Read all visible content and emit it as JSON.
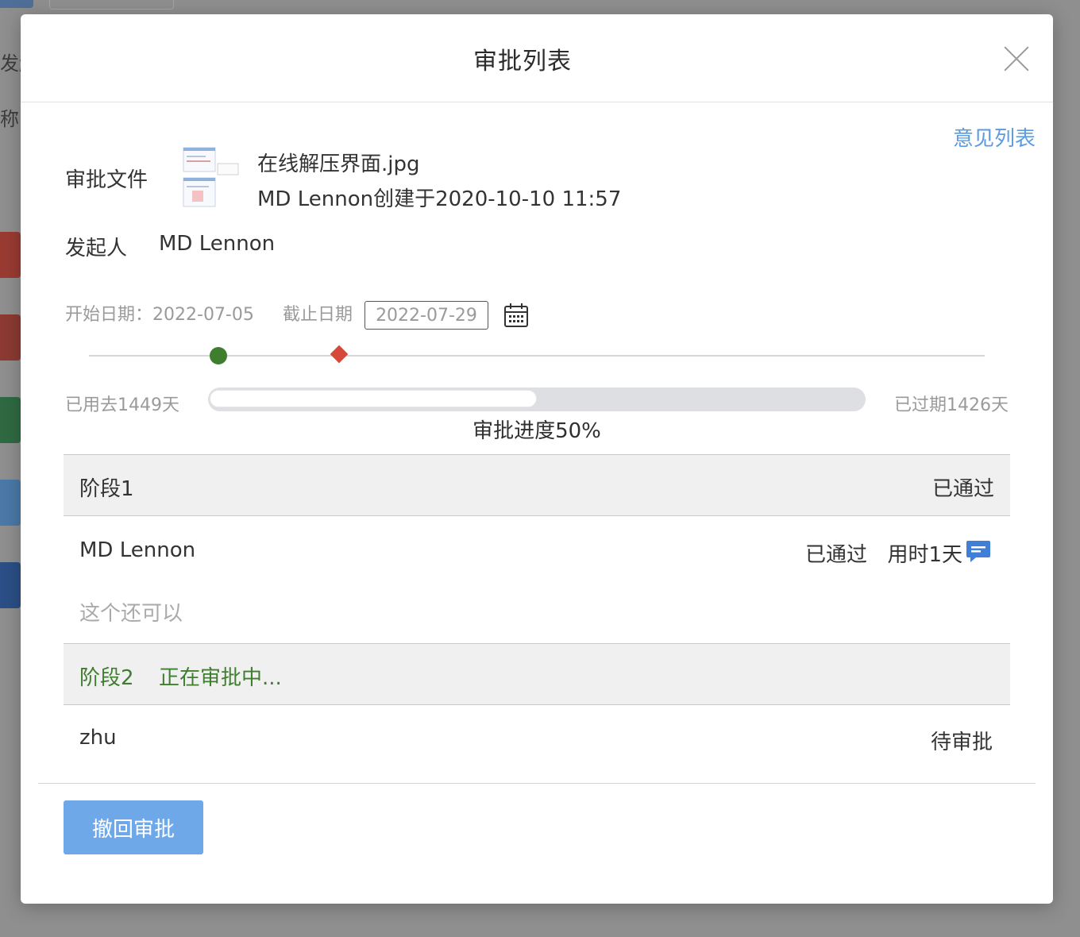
{
  "background": {
    "side_texts": [
      "发起",
      "称"
    ]
  },
  "modal": {
    "title": "审批列表",
    "opinion_link": "意见列表",
    "file_label": "审批文件",
    "file_name": "在线解压界面.jpg",
    "file_meta": "MD Lennon创建于2020-10-10 11:57",
    "initiator_label": "发起人",
    "initiator_name": "MD Lennon",
    "start_label": "开始日期：",
    "start_date": "2022-07-05",
    "end_label": "截止日期",
    "end_date": "2022-07-29",
    "used_days": "已用去1449天",
    "expired_days": "已过期1426天",
    "progress_label": "审批进度50%",
    "progress_fraction": 0.5,
    "stages": [
      {
        "title": "阶段1",
        "status": "已通过",
        "approver": "MD Lennon",
        "approver_status": "已通过",
        "duration": "用时1天",
        "comment": "这个还可以"
      },
      {
        "title": "阶段2",
        "status": "正在审批中...",
        "approver": "zhu",
        "approver_status": "待审批"
      }
    ],
    "revoke_button": "撤回审批"
  },
  "colors": {
    "accent": "#5b9be0",
    "button": "#6fa8e8",
    "green": "#3f7e2e",
    "red": "#d6493a"
  },
  "icons": [
    "close-icon",
    "calendar-icon",
    "chat-bubble-icon",
    "image-thumbnail"
  ]
}
